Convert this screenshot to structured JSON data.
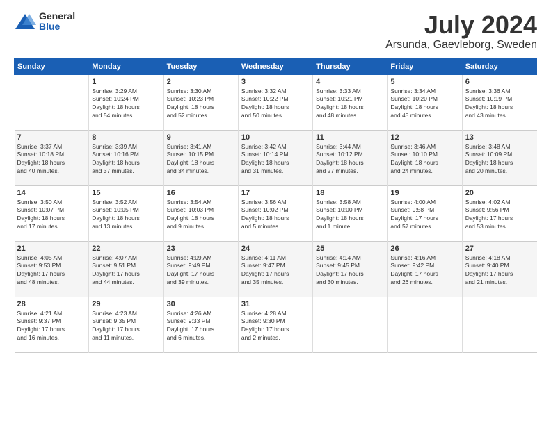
{
  "header": {
    "logo_general": "General",
    "logo_blue": "Blue",
    "month_year": "July 2024",
    "location": "Arsunda, Gaevleborg, Sweden"
  },
  "days_of_week": [
    "Sunday",
    "Monday",
    "Tuesday",
    "Wednesday",
    "Thursday",
    "Friday",
    "Saturday"
  ],
  "weeks": [
    [
      {
        "day": "",
        "content": ""
      },
      {
        "day": "1",
        "content": "Sunrise: 3:29 AM\nSunset: 10:24 PM\nDaylight: 18 hours\nand 54 minutes."
      },
      {
        "day": "2",
        "content": "Sunrise: 3:30 AM\nSunset: 10:23 PM\nDaylight: 18 hours\nand 52 minutes."
      },
      {
        "day": "3",
        "content": "Sunrise: 3:32 AM\nSunset: 10:22 PM\nDaylight: 18 hours\nand 50 minutes."
      },
      {
        "day": "4",
        "content": "Sunrise: 3:33 AM\nSunset: 10:21 PM\nDaylight: 18 hours\nand 48 minutes."
      },
      {
        "day": "5",
        "content": "Sunrise: 3:34 AM\nSunset: 10:20 PM\nDaylight: 18 hours\nand 45 minutes."
      },
      {
        "day": "6",
        "content": "Sunrise: 3:36 AM\nSunset: 10:19 PM\nDaylight: 18 hours\nand 43 minutes."
      }
    ],
    [
      {
        "day": "7",
        "content": "Sunrise: 3:37 AM\nSunset: 10:18 PM\nDaylight: 18 hours\nand 40 minutes."
      },
      {
        "day": "8",
        "content": "Sunrise: 3:39 AM\nSunset: 10:16 PM\nDaylight: 18 hours\nand 37 minutes."
      },
      {
        "day": "9",
        "content": "Sunrise: 3:41 AM\nSunset: 10:15 PM\nDaylight: 18 hours\nand 34 minutes."
      },
      {
        "day": "10",
        "content": "Sunrise: 3:42 AM\nSunset: 10:14 PM\nDaylight: 18 hours\nand 31 minutes."
      },
      {
        "day": "11",
        "content": "Sunrise: 3:44 AM\nSunset: 10:12 PM\nDaylight: 18 hours\nand 27 minutes."
      },
      {
        "day": "12",
        "content": "Sunrise: 3:46 AM\nSunset: 10:10 PM\nDaylight: 18 hours\nand 24 minutes."
      },
      {
        "day": "13",
        "content": "Sunrise: 3:48 AM\nSunset: 10:09 PM\nDaylight: 18 hours\nand 20 minutes."
      }
    ],
    [
      {
        "day": "14",
        "content": "Sunrise: 3:50 AM\nSunset: 10:07 PM\nDaylight: 18 hours\nand 17 minutes."
      },
      {
        "day": "15",
        "content": "Sunrise: 3:52 AM\nSunset: 10:05 PM\nDaylight: 18 hours\nand 13 minutes."
      },
      {
        "day": "16",
        "content": "Sunrise: 3:54 AM\nSunset: 10:03 PM\nDaylight: 18 hours\nand 9 minutes."
      },
      {
        "day": "17",
        "content": "Sunrise: 3:56 AM\nSunset: 10:02 PM\nDaylight: 18 hours\nand 5 minutes."
      },
      {
        "day": "18",
        "content": "Sunrise: 3:58 AM\nSunset: 10:00 PM\nDaylight: 18 hours\nand 1 minute."
      },
      {
        "day": "19",
        "content": "Sunrise: 4:00 AM\nSunset: 9:58 PM\nDaylight: 17 hours\nand 57 minutes."
      },
      {
        "day": "20",
        "content": "Sunrise: 4:02 AM\nSunset: 9:56 PM\nDaylight: 17 hours\nand 53 minutes."
      }
    ],
    [
      {
        "day": "21",
        "content": "Sunrise: 4:05 AM\nSunset: 9:53 PM\nDaylight: 17 hours\nand 48 minutes."
      },
      {
        "day": "22",
        "content": "Sunrise: 4:07 AM\nSunset: 9:51 PM\nDaylight: 17 hours\nand 44 minutes."
      },
      {
        "day": "23",
        "content": "Sunrise: 4:09 AM\nSunset: 9:49 PM\nDaylight: 17 hours\nand 39 minutes."
      },
      {
        "day": "24",
        "content": "Sunrise: 4:11 AM\nSunset: 9:47 PM\nDaylight: 17 hours\nand 35 minutes."
      },
      {
        "day": "25",
        "content": "Sunrise: 4:14 AM\nSunset: 9:45 PM\nDaylight: 17 hours\nand 30 minutes."
      },
      {
        "day": "26",
        "content": "Sunrise: 4:16 AM\nSunset: 9:42 PM\nDaylight: 17 hours\nand 26 minutes."
      },
      {
        "day": "27",
        "content": "Sunrise: 4:18 AM\nSunset: 9:40 PM\nDaylight: 17 hours\nand 21 minutes."
      }
    ],
    [
      {
        "day": "28",
        "content": "Sunrise: 4:21 AM\nSunset: 9:37 PM\nDaylight: 17 hours\nand 16 minutes."
      },
      {
        "day": "29",
        "content": "Sunrise: 4:23 AM\nSunset: 9:35 PM\nDaylight: 17 hours\nand 11 minutes."
      },
      {
        "day": "30",
        "content": "Sunrise: 4:26 AM\nSunset: 9:33 PM\nDaylight: 17 hours\nand 6 minutes."
      },
      {
        "day": "31",
        "content": "Sunrise: 4:28 AM\nSunset: 9:30 PM\nDaylight: 17 hours\nand 2 minutes."
      },
      {
        "day": "",
        "content": ""
      },
      {
        "day": "",
        "content": ""
      },
      {
        "day": "",
        "content": ""
      }
    ]
  ]
}
